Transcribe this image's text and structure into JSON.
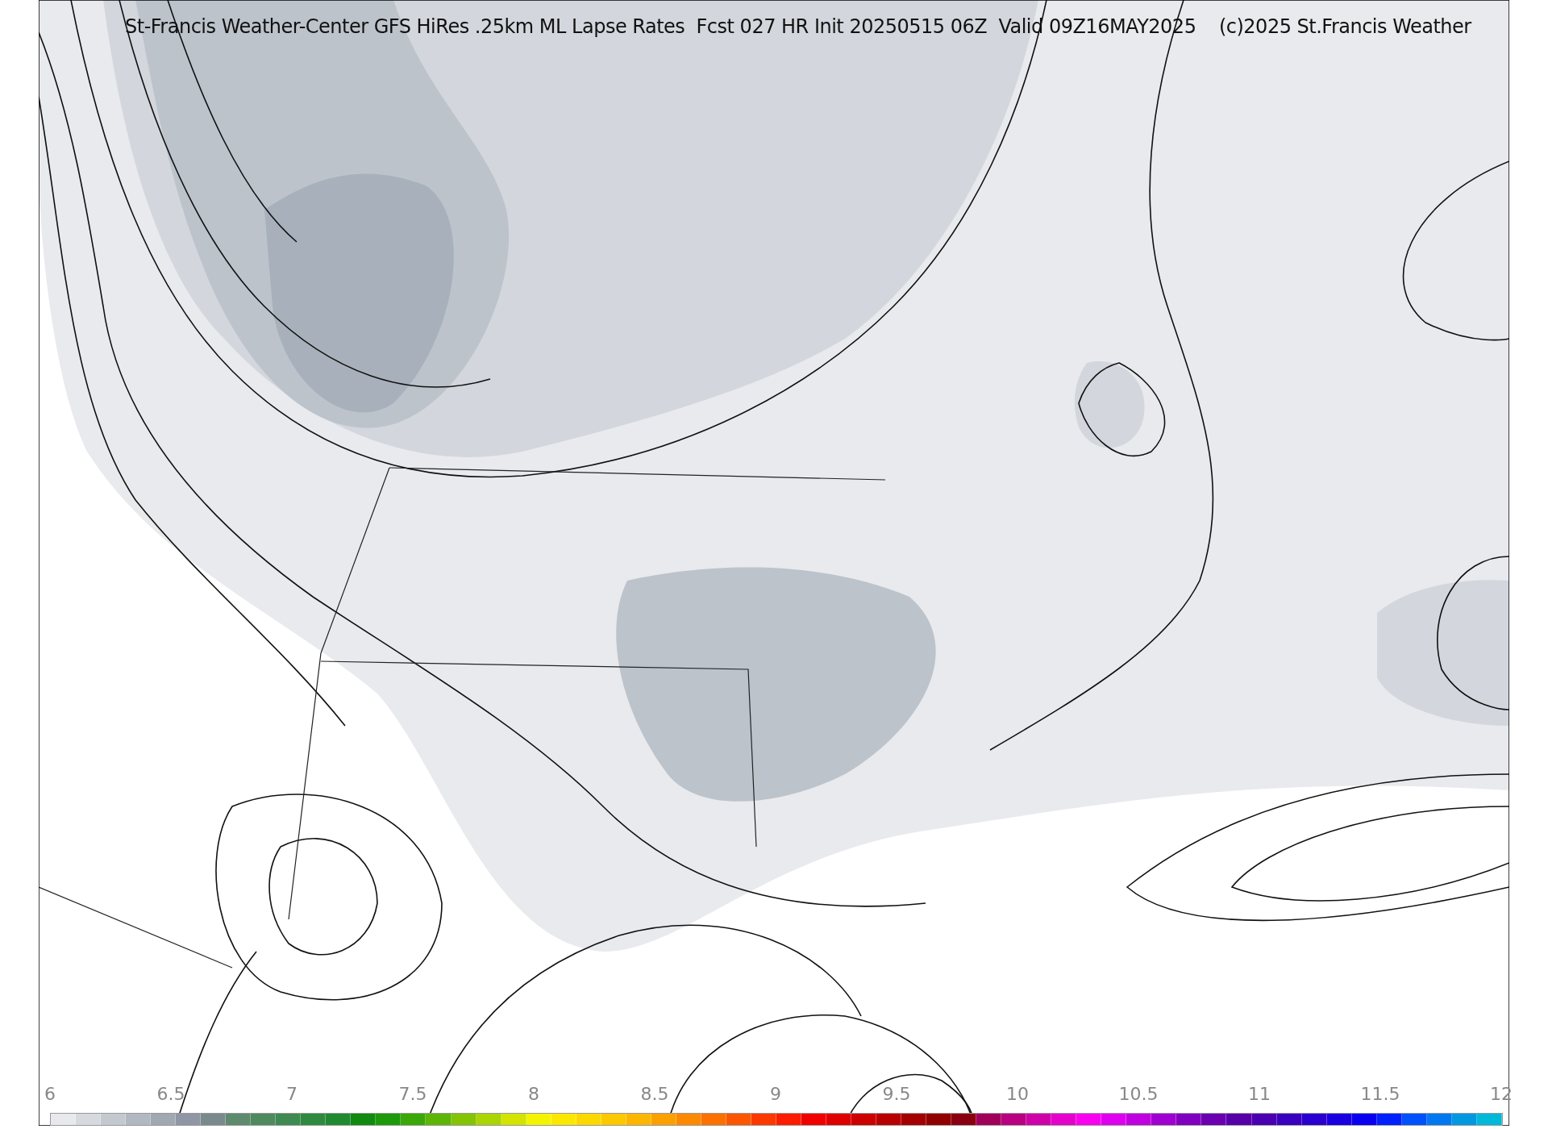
{
  "title": "St-Francis Weather-Center GFS HiRes .25km ML Lapse Rates  Fcst 027 HR Init 20250515 06Z  Valid 09Z16MAY2025    (c)2025 St.Francis Weather",
  "colorbar": {
    "ticks": [
      "6",
      "6.5",
      "7",
      "7.5",
      "8",
      "8.5",
      "9",
      "9.5",
      "10",
      "10.5",
      "11",
      "11.5",
      "12"
    ]
  }
}
